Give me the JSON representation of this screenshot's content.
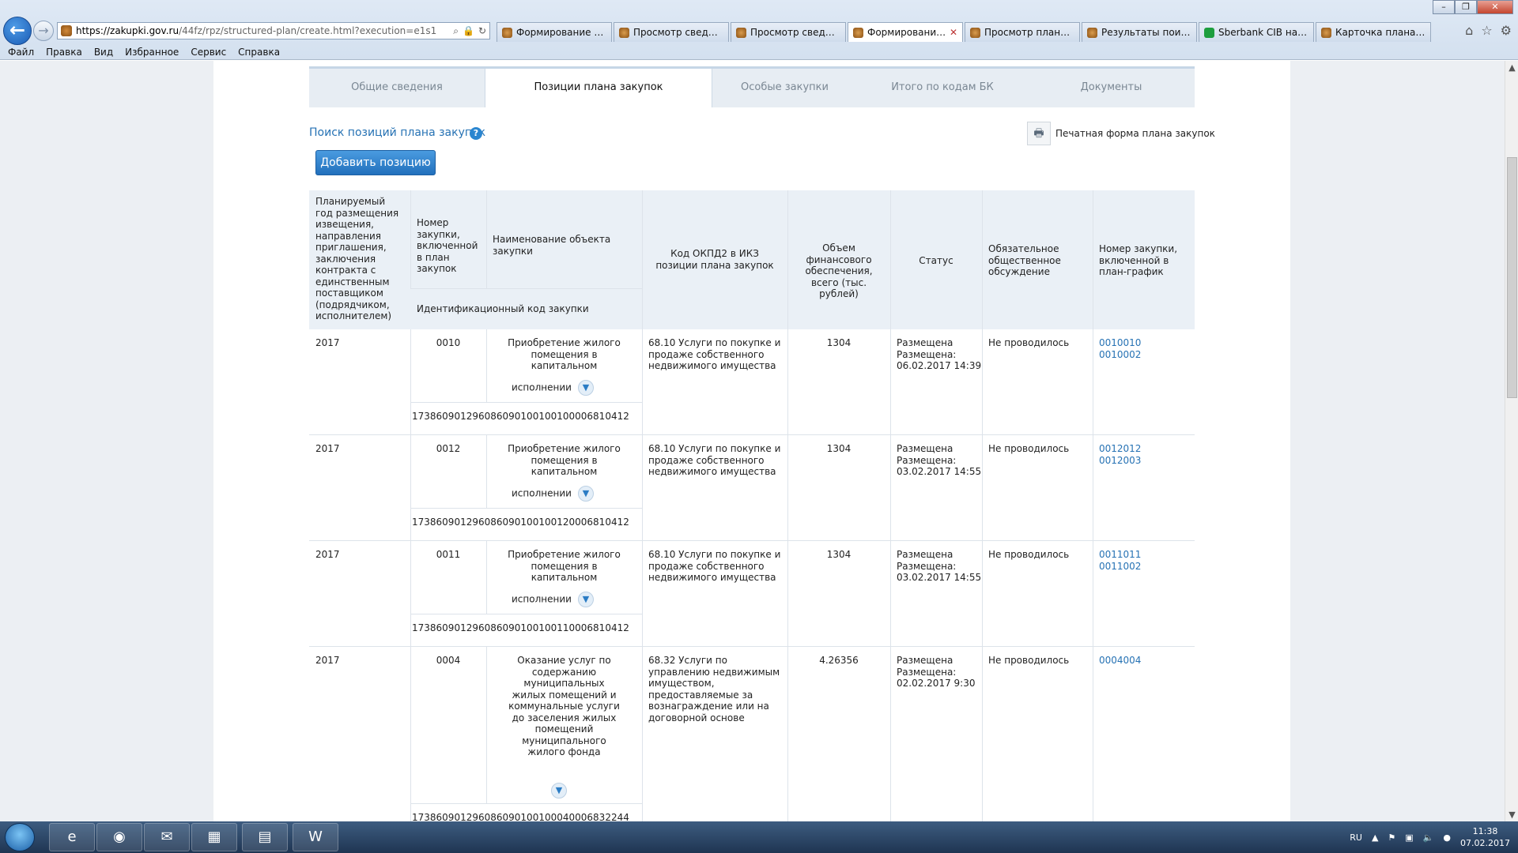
{
  "browser": {
    "url_host": "https://zakupki.gov.ru",
    "url_path": "/44fz/rpz/structured-plan/create.html?execution=e1s1",
    "tabs": [
      {
        "label": "Формирование ин...",
        "icon": "gov-emblem-icon",
        "active": false
      },
      {
        "label": "Просмотр сведени...",
        "icon": "gov-emblem-icon",
        "active": false
      },
      {
        "label": "Просмотр сведени...",
        "icon": "gov-emblem-icon",
        "active": false
      },
      {
        "label": "Формирование ...",
        "icon": "gov-emblem-icon",
        "active": true
      },
      {
        "label": "Просмотр плана за...",
        "icon": "gov-emblem-icon",
        "active": false
      },
      {
        "label": "Результаты поиска",
        "icon": "gov-emblem-icon",
        "active": false
      },
      {
        "label": "Sberbank CIB назва...",
        "icon": "sberbank-icon",
        "active": false
      },
      {
        "label": "Карточка плана-гр...",
        "icon": "gov-emblem-icon",
        "active": false
      }
    ],
    "menu": [
      "Файл",
      "Правка",
      "Вид",
      "Избранное",
      "Сервис",
      "Справка"
    ]
  },
  "page": {
    "tabs": [
      "Общие сведения",
      "Позиции плана закупок",
      "Особые закупки",
      "Итого по кодам БК",
      "Документы"
    ],
    "active_tab": 1,
    "search_link": "Поиск позиций плана закупок",
    "help_icon": "?",
    "print_label": "Печатная форма плана закупок",
    "add_button": "Добавить позицию"
  },
  "table": {
    "headers": {
      "year": "Планируемый год размещения извещения, направления приглашения, заключения контракта с единственным поставщиком (подрядчиком, исполнителем)",
      "number": "Номер закупки, включенной в план закупок",
      "name": "Наименование объекта закупки",
      "ikz": "Идентификационный код закупки",
      "okpd": "Код ОКПД2 в ИКЗ позиции плана закупок",
      "volume": "Объем финансового обеспечения, всего (тыс. рублей)",
      "status": "Статус",
      "discussion": "Обязательное общественное обсуждение",
      "schedule": "Номер закупки, включенной в план-график"
    },
    "rows": [
      {
        "year": "2017",
        "number": "0010",
        "name": "Приобретение жилого помещения в капитальном",
        "name_more": "исполнении",
        "ikz": "173860901296086090100100100006810412",
        "okpd": "68.10 Услуги по покупке и продаже собственного недвижимого имущества",
        "volume": "1304",
        "status": "Размещена",
        "status_date": "Размещена: 06.02.2017 14:39",
        "discussion": "Не проводилось",
        "links": [
          "0010010",
          "0010002"
        ]
      },
      {
        "year": "2017",
        "number": "0012",
        "name": "Приобретение жилого помещения в капитальном",
        "name_more": "исполнении",
        "ikz": "173860901296086090100100120006810412",
        "okpd": "68.10 Услуги по покупке и продаже собственного недвижимого имущества",
        "volume": "1304",
        "status": "Размещена",
        "status_date": "Размещена: 03.02.2017 14:55",
        "discussion": "Не проводилось",
        "links": [
          "0012012",
          "0012003"
        ]
      },
      {
        "year": "2017",
        "number": "0011",
        "name": "Приобретение жилого помещения в капитальном",
        "name_more": "исполнении",
        "ikz": "173860901296086090100100110006810412",
        "okpd": "68.10 Услуги по покупке и продаже собственного недвижимого имущества",
        "volume": "1304",
        "status": "Размещена",
        "status_date": "Размещена: 03.02.2017 14:55",
        "discussion": "Не проводилось",
        "links": [
          "0011011",
          "0011002"
        ]
      },
      {
        "year": "2017",
        "number": "0004",
        "name": "Оказание услуг по содержанию муниципальных жилых помещений и коммунальные услуги до заселения жилых помещений муниципального жилого фонда",
        "name_more": "",
        "ikz": "173860901296086090100100040006832244",
        "okpd": "68.32 Услуги по управлению недвижимым имуществом, предоставляемые за вознаграждение или на договорной основе",
        "volume": "4.26356",
        "status": "Размещена",
        "status_date": "Размещена: 02.02.2017 9:30",
        "discussion": "Не проводилось",
        "links": [
          "0004004"
        ]
      }
    ]
  },
  "taskbar": {
    "apps": [
      "ie-icon",
      "chrome-icon",
      "outlook-icon",
      "calculator-icon",
      "explorer-icon",
      "word-icon"
    ],
    "lang": "RU",
    "time": "11:38",
    "date": "07.02.2017"
  }
}
